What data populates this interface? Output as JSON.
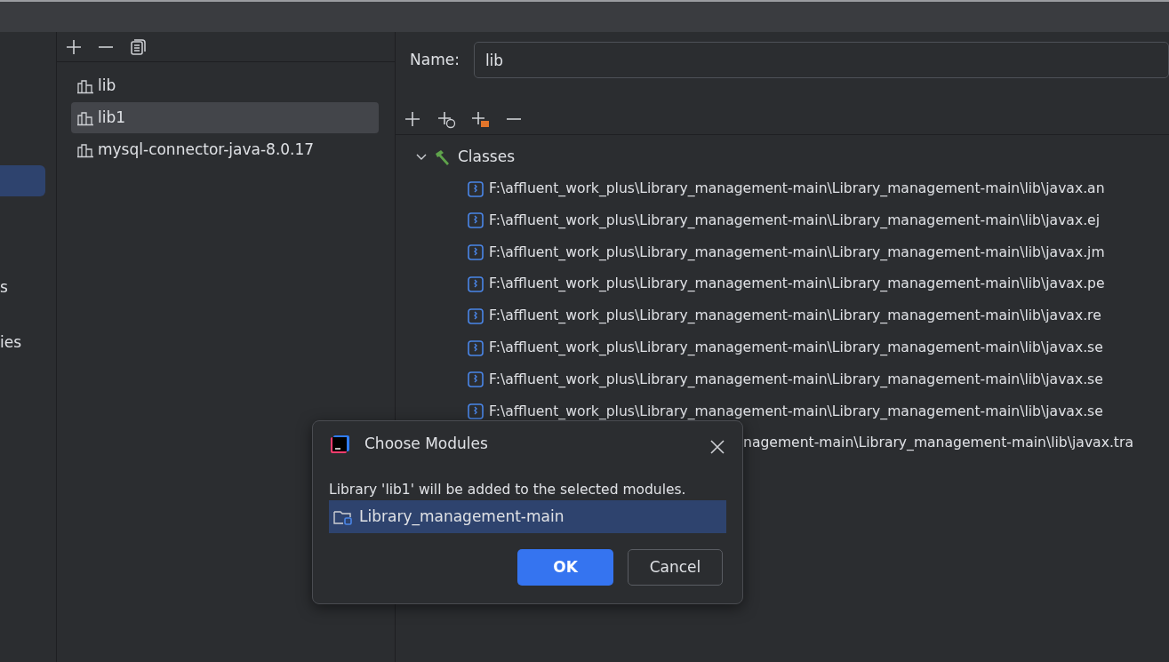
{
  "sidebar": {
    "items": [
      {
        "selected": true
      },
      {
        "label": "s",
        "selected": false
      },
      {
        "label": "ies",
        "selected": false
      }
    ]
  },
  "libraries": {
    "toolbar": [
      {
        "kind": "add"
      },
      {
        "kind": "remove"
      },
      {
        "kind": "copy"
      }
    ],
    "items": [
      {
        "label": "lib",
        "selected": false
      },
      {
        "label": "lib1",
        "selected": true
      },
      {
        "label": "mysql-connector-java-8.0.17",
        "selected": false
      }
    ]
  },
  "details": {
    "name_label": "Name:",
    "name_value": "lib",
    "toolbar": [
      {
        "kind": "add"
      },
      {
        "kind": "add-web"
      },
      {
        "kind": "add-folder"
      },
      {
        "kind": "remove"
      }
    ],
    "tree": {
      "label": "Classes",
      "expanded": true,
      "children": [
        {
          "label": "F:\\affluent_work_plus\\Library_management-main\\Library_management-main\\lib\\javax.an"
        },
        {
          "label": "F:\\affluent_work_plus\\Library_management-main\\Library_management-main\\lib\\javax.ej"
        },
        {
          "label": "F:\\affluent_work_plus\\Library_management-main\\Library_management-main\\lib\\javax.jm"
        },
        {
          "label": "F:\\affluent_work_plus\\Library_management-main\\Library_management-main\\lib\\javax.pe"
        },
        {
          "label": "F:\\affluent_work_plus\\Library_management-main\\Library_management-main\\lib\\javax.re"
        },
        {
          "label": "F:\\affluent_work_plus\\Library_management-main\\Library_management-main\\lib\\javax.se"
        },
        {
          "label": "F:\\affluent_work_plus\\Library_management-main\\Library_management-main\\lib\\javax.se"
        },
        {
          "label": "F:\\affluent_work_plus\\Library_management-main\\Library_management-main\\lib\\javax.se"
        },
        {
          "label": "nagement-main\\Library_management-main\\lib\\javax.tra"
        }
      ]
    }
  },
  "dialog": {
    "title": "Choose Modules",
    "message": "Library 'lib1' will be added to the selected modules.",
    "modules": [
      {
        "label": "Library_management-main",
        "selected": true
      }
    ],
    "buttons": [
      {
        "label": "OK",
        "kind": "primary"
      },
      {
        "label": "Cancel",
        "kind": "secondary"
      }
    ]
  }
}
